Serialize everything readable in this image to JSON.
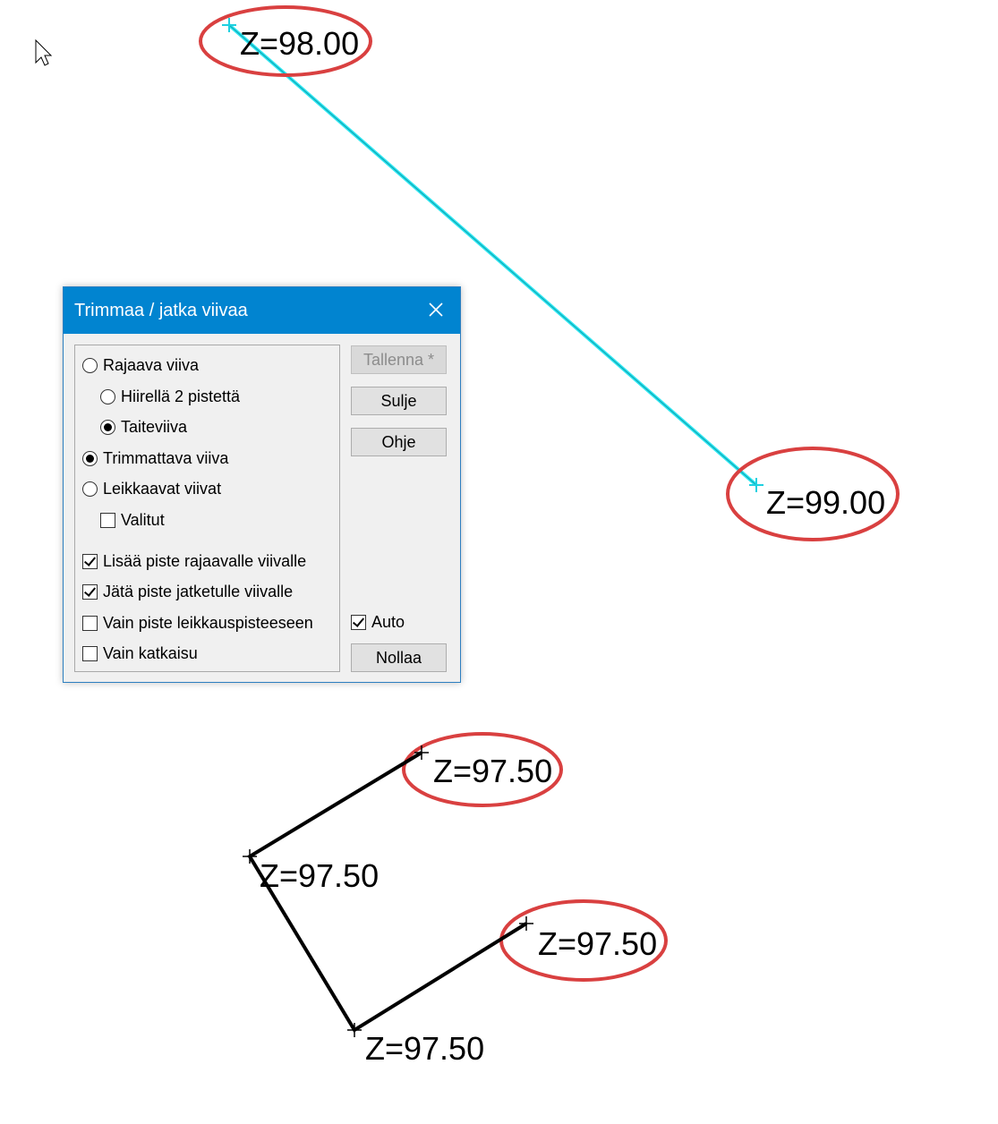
{
  "canvas": {
    "labels": {
      "top": "Z=98.00",
      "right": "Z=99.00",
      "bottom_top": "Z=97.50",
      "bottom_left": "Z=97.50",
      "bottom_right": "Z=97.50",
      "bottom_low": "Z=97.50"
    },
    "colors": {
      "highlight_line": "#2ee6f0",
      "ellipse": "#d94040",
      "polyline": "#000000"
    }
  },
  "dialog": {
    "title": "Trimmaa / jatka viivaa",
    "options": {
      "rajaava_viiva": "Rajaava viiva",
      "hiirella": "Hiirellä 2 pistettä",
      "taiteviiva": "Taiteviiva",
      "trimmattava": "Trimmattava viiva",
      "leikkaavat": "Leikkaavat viivat",
      "valitut": "Valitut",
      "lisaa_piste": "Lisää piste rajaavalle viivalle",
      "jata_piste": "Jätä piste jatketulle viivalle",
      "vain_piste": "Vain piste leikkauspisteeseen",
      "vain_katkaisu": "Vain katkaisu",
      "auto": "Auto"
    },
    "buttons": {
      "tallenna": "Tallenna *",
      "sulje": "Sulje",
      "ohje": "Ohje",
      "nollaa": "Nollaa"
    },
    "colors": {
      "titlebar": "#0184d0"
    }
  }
}
